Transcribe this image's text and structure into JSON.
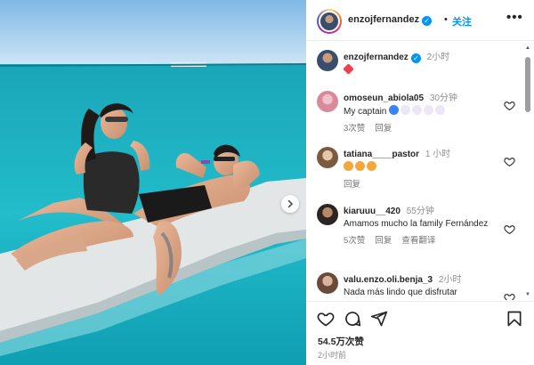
{
  "header": {
    "username": "enzojfernandez",
    "separator": "•",
    "follow_label": "关注",
    "more_label": "•••"
  },
  "caption": {
    "username": "enzojfernandez",
    "time": "2小时",
    "emoji": "heart-emoji"
  },
  "comments": [
    {
      "username": "omoseun_abiola05",
      "time": "30分钟",
      "text": "My captain",
      "emoji": [
        "blue-heart",
        "white-heart",
        "white-heart",
        "white-heart",
        "white-heart"
      ],
      "replies": "3次赞",
      "reply_label": "回复",
      "translate": ""
    },
    {
      "username": "tatiana____pastor",
      "time": "1 小时",
      "text": "",
      "emoji": [
        "heart-eyes",
        "heart-eyes",
        "heart-eyes"
      ],
      "replies": "",
      "reply_label": "回复",
      "translate": ""
    },
    {
      "username": "kiaruuu__420",
      "time": "55分钟",
      "text": "Amamos mucho la family Fernández",
      "emoji": [],
      "replies": "5次赞",
      "reply_label": "回复",
      "translate": "查看翻译"
    },
    {
      "username": "valu.enzo.oli.benja_3",
      "time": "2小时",
      "text": "Nada más lindo que disfrutar",
      "emoji": [],
      "replies": "",
      "reply_label": "",
      "translate": ""
    }
  ],
  "footer": {
    "likes": "54.5万次赞",
    "posted": "2小时前"
  },
  "icons": {
    "like": "heart-icon",
    "comment": "comment-icon",
    "share": "send-icon",
    "save": "bookmark-icon",
    "next": "chevron-right-icon"
  },
  "colors": {
    "accent": "#0095f6",
    "sea": "#1bb5c4",
    "float": "#dfe3e4"
  }
}
